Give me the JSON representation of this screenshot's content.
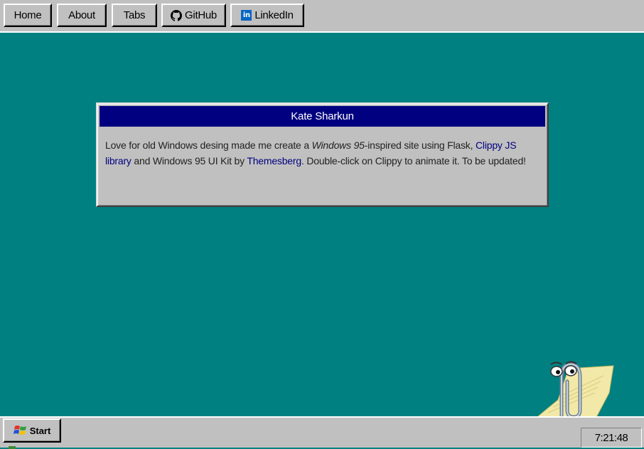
{
  "nav": {
    "home": "Home",
    "about": "About",
    "tabs": "Tabs",
    "github": "GitHub",
    "linkedin": "LinkedIn"
  },
  "window": {
    "title": "Kate Sharkun",
    "body": {
      "part1": "Love for old Windows desing made me create a ",
      "italic": "Windows 95",
      "part2": "-inspired site using Flask, ",
      "link_clippy": "Clippy JS library",
      "part3": " and Windows 95 UI Kit by ",
      "link_themesberg": "Themesberg",
      "part4": ". Double-click on Clippy to animate it. To be updated!"
    }
  },
  "taskbar": {
    "start_label": "Start",
    "clock": "7:21:48"
  },
  "colors": {
    "desktop": "#008080",
    "title_bar": "#000080",
    "chrome": "#c0c0c0",
    "link": "#000080"
  },
  "icons": [
    "github-icon",
    "linkedin-icon",
    "windows-logo-icon",
    "clippy-assistant"
  ]
}
